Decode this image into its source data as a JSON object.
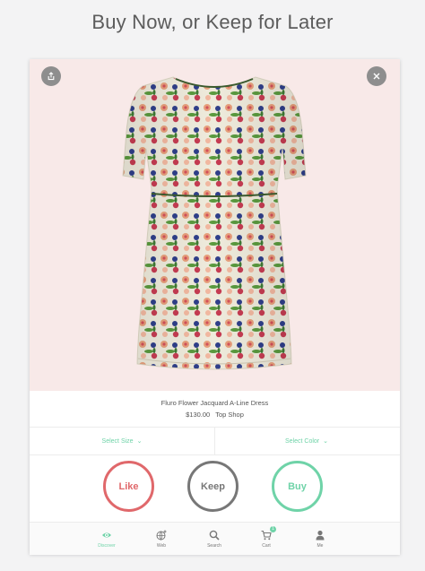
{
  "headline": "Buy Now, or Keep for Later",
  "product": {
    "name": "Fluro Flower Jacquard A-Line Dress",
    "price": "$130.00",
    "store": "Top Shop"
  },
  "selectors": {
    "size_label": "Select Size",
    "color_label": "Select Color"
  },
  "actions": {
    "like": "Like",
    "keep": "Keep",
    "buy": "Buy"
  },
  "tabs": [
    {
      "label": "Discover",
      "icon": "eye-icon",
      "active": true
    },
    {
      "label": "Web",
      "icon": "globe-plus-icon"
    },
    {
      "label": "Search",
      "icon": "search-icon"
    },
    {
      "label": "Cart",
      "icon": "cart-icon",
      "badge": "1"
    },
    {
      "label": "Me",
      "icon": "person-icon"
    }
  ],
  "colors": {
    "accent": "#6fd3a8",
    "like": "#e0686b",
    "keep": "#777777",
    "hero_bg": "#f8e9e8"
  }
}
